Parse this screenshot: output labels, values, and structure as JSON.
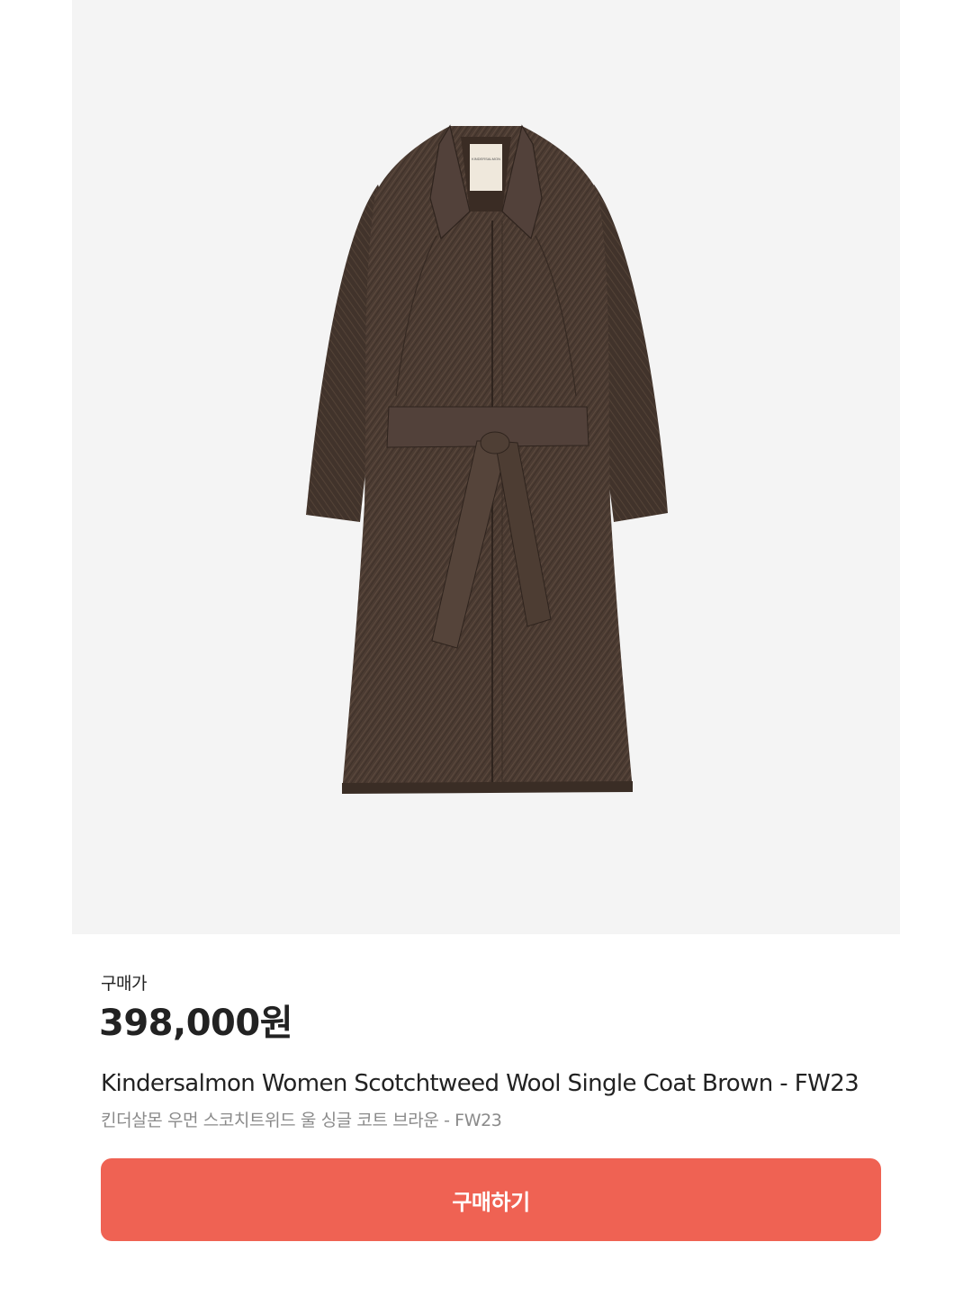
{
  "product": {
    "image_background": "#f4f4f4",
    "image_subject": "brown tweed belted single coat",
    "coat_color": "#4a3a31",
    "label_text": "KINDERSALMON",
    "price_label": "구매가",
    "price": "398,000원",
    "name_en": "Kindersalmon Women Scotchtweed Wool Single Coat Brown - FW23",
    "name_ko": "킨더살몬 우먼 스코치트위드 울 싱글 코트 브라운 - FW23"
  },
  "actions": {
    "buy_label": "구매하기",
    "buy_color": "#ef6253"
  }
}
